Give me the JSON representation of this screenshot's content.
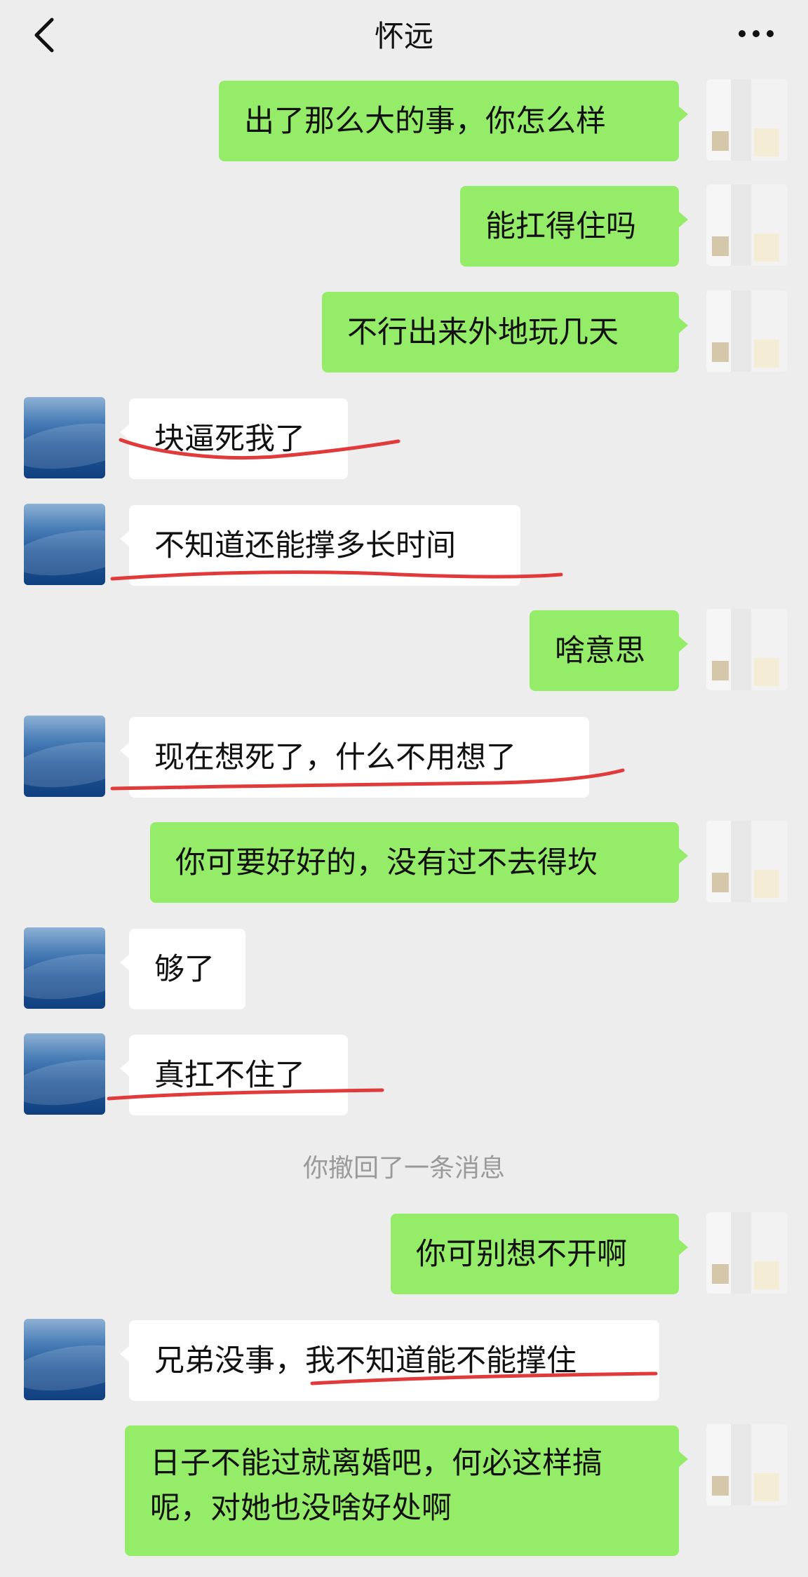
{
  "header": {
    "title": "怀远",
    "back_icon": "chevron-left-icon",
    "more_icon": "more-dots-icon"
  },
  "colors": {
    "background": "#ededed",
    "self_bubble": "#95ec69",
    "other_bubble": "#ffffff",
    "annotation_underline": "#e03a3a",
    "system_text": "#9a9a9a"
  },
  "messages": [
    {
      "sender": "self",
      "text": "出了那么大的事，你怎么样"
    },
    {
      "sender": "self",
      "text": "能扛得住吗"
    },
    {
      "sender": "self",
      "text": "不行出来外地玩几天"
    },
    {
      "sender": "other",
      "text": "块逼死我了",
      "underlined": true
    },
    {
      "sender": "other",
      "text": "不知道还能撑多长时间",
      "underlined": true
    },
    {
      "sender": "self",
      "text": "啥意思"
    },
    {
      "sender": "other",
      "text": "现在想死了，什么不用想了",
      "underlined": true
    },
    {
      "sender": "self",
      "text": "你可要好好的，没有过不去得坎"
    },
    {
      "sender": "other",
      "text": "够了"
    },
    {
      "sender": "other",
      "text": "真扛不住了",
      "underlined": true
    },
    {
      "sender": "self",
      "text": "你可别想不开啊"
    },
    {
      "sender": "other",
      "text": "兄弟没事，我不知道能不能撑住",
      "underlined": true
    },
    {
      "sender": "self",
      "text": "日子不能过就离婚吧，何必这样搞呢，对她也没啥好处啊"
    }
  ],
  "system_message": "你撤回了一条消息"
}
